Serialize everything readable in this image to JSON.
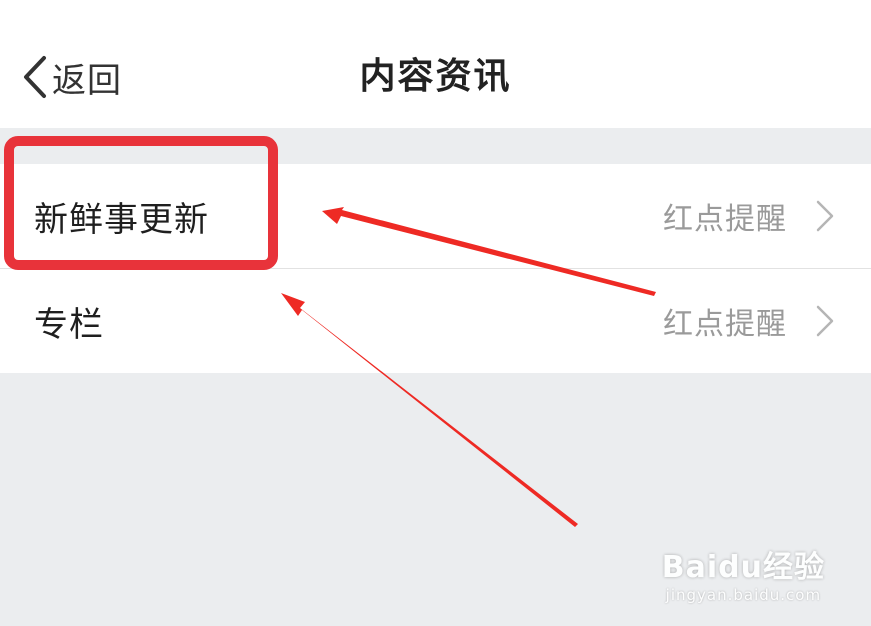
{
  "nav": {
    "back_label": "返回",
    "title": "内容资讯",
    "back_icon": "chevron-left-icon"
  },
  "settings": {
    "rows": [
      {
        "label": "新鲜事更新",
        "value": "红点提醒",
        "icon": "chevron-right-icon"
      },
      {
        "label": "专栏",
        "value": "红点提醒",
        "icon": "chevron-right-icon"
      }
    ]
  },
  "annotation": {
    "highlight_color": "#e8333a",
    "arrow_color": "#ee2a24",
    "highlighted_item": "新鲜事更新"
  },
  "watermark": {
    "logo": "Baidu经验",
    "url": "jingyan.baidu.com"
  }
}
